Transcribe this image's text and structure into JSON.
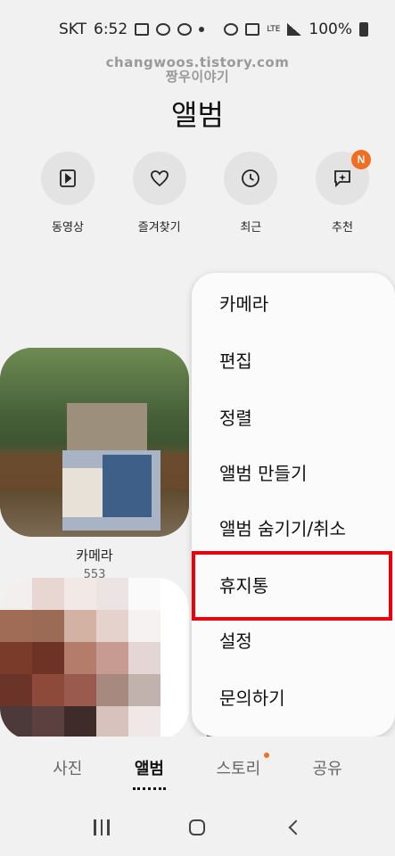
{
  "status_bar": {
    "carrier": "SKT",
    "time": "6:52",
    "network": "LTE",
    "battery": "100%"
  },
  "watermark": {
    "line1": "changwoos.tistory.com",
    "line2": "짱우이야기"
  },
  "page_title": "앨범",
  "quick_actions": [
    {
      "label": "동영상",
      "icon": "play-icon"
    },
    {
      "label": "즐겨찾기",
      "icon": "heart-icon"
    },
    {
      "label": "최근",
      "icon": "clock-icon"
    },
    {
      "label": "추천",
      "icon": "sparkle-chat-icon",
      "badge": "N"
    }
  ],
  "albums": [
    {
      "name": "카메라",
      "count": "553"
    }
  ],
  "menu": {
    "items": [
      "카메라",
      "편집",
      "정렬",
      "앨범 만들기",
      "앨범 숨기기/취소",
      "휴지통",
      "설정",
      "문의하기"
    ],
    "highlighted": "휴지통"
  },
  "tabs": [
    {
      "label": "사진",
      "active": false
    },
    {
      "label": "앨범",
      "active": true
    },
    {
      "label": "스토리",
      "active": false,
      "dot": true
    },
    {
      "label": "공유",
      "active": false
    }
  ],
  "colors": {
    "accent_badge": "#f26e22",
    "highlight_box": "#e8000d"
  }
}
